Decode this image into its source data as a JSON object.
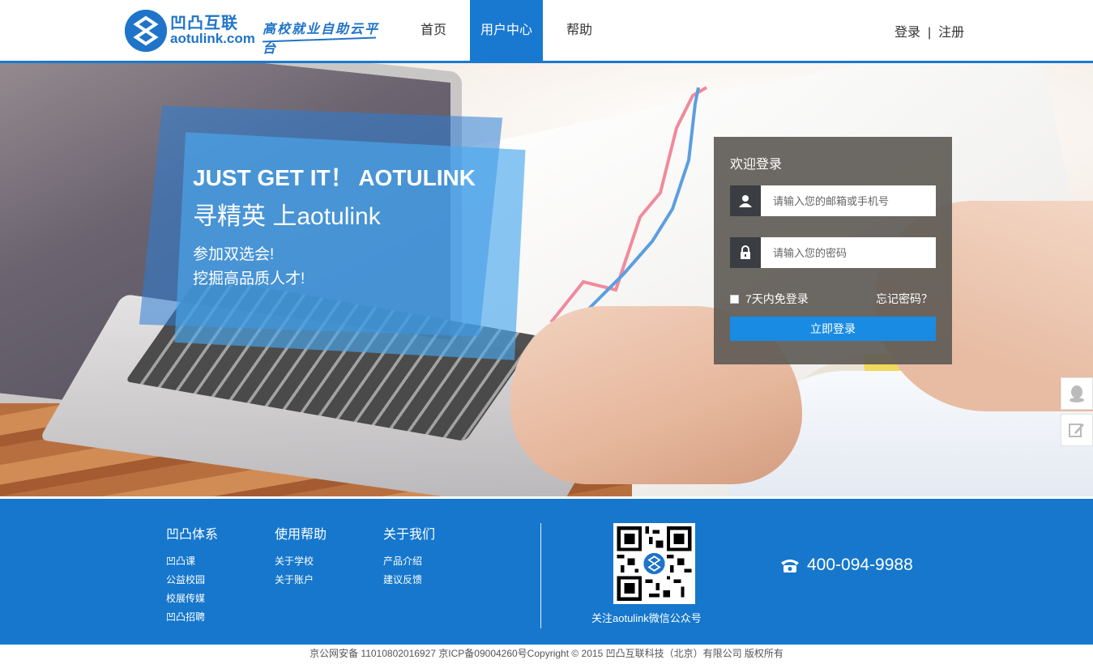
{
  "header": {
    "logo_name": "凹凸互联",
    "logo_domain": "aotulink.com",
    "logo_slogan": "高校就业自助云平台",
    "nav": [
      "首页",
      "用户中心",
      "帮助"
    ],
    "active_nav": "用户中心",
    "login_link": "登录",
    "separator": "|",
    "register_link": "注册"
  },
  "banner": {
    "headline": "JUST GET IT！ AOTULINK",
    "subheadline": "寻精英  上aotulink",
    "line1": "参加双选会!",
    "line2": "挖掘高品质人才!"
  },
  "login": {
    "title": "欢迎登录",
    "username_placeholder": "请输入您的邮箱或手机号",
    "password_placeholder": "请输入您的密码",
    "remember_label": "7天内免登录",
    "forgot_label": "忘记密码？",
    "submit_label": "立即登录"
  },
  "side_buttons": [
    "qq-icon",
    "feedback-edit-icon"
  ],
  "footer": {
    "columns": [
      {
        "title": "凹凸体系",
        "links": [
          "凹凸课",
          "公益校园",
          "校展传媒",
          "凹凸招聘"
        ]
      },
      {
        "title": "使用帮助",
        "links": [
          "关于学校",
          "关于账户"
        ]
      },
      {
        "title": "关于我们",
        "links": [
          "产品介绍",
          "建议反馈"
        ]
      }
    ],
    "qr_caption": "关注aotulink微信公众号",
    "phone": "400-094-9988"
  },
  "copyright": "京公网安备 11010802016927 京ICP备09004260号Copyright © 2015 凹凸互联科技（北京）有限公司 版权所有",
  "colors": {
    "brand": "#1979d0",
    "footer_bg": "#1677cc",
    "login_button": "#1a8be3",
    "login_panel": "#5f5b56"
  }
}
